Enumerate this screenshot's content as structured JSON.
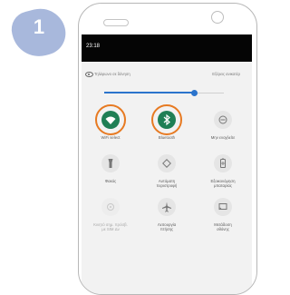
{
  "badge": {
    "number": "1",
    "color": "#a8b8dc"
  },
  "status_bar": {
    "time": "23:18"
  },
  "top_row": {
    "left_text": "Τηλέφωνο σε δόνηση",
    "right_text": "Εξέρεις ανικατέρ"
  },
  "brightness": {
    "level": 0.75,
    "accent": "#2b74cc"
  },
  "tiles": [
    {
      "name": "wifi",
      "icon": "wifi-icon",
      "label": "WiFi select",
      "active": true,
      "highlighted": true
    },
    {
      "name": "bluetooth",
      "icon": "bluetooth-icon",
      "label": "Bluetooth",
      "active": true,
      "highlighted": true
    },
    {
      "name": "do-not-disturb",
      "icon": "minus-circle-icon",
      "label": "Μην ενοχλείτε",
      "active": false
    },
    {
      "name": "flashlight",
      "icon": "flashlight-icon",
      "label": "Φακός",
      "active": false
    },
    {
      "name": "auto-rotate",
      "icon": "rotate-icon",
      "label": "Αυτόματη\nπεριστροφή",
      "active": false
    },
    {
      "name": "battery-saver",
      "icon": "battery-icon",
      "label": "Εξοικονόμηση\nμπαταρίας",
      "active": false
    },
    {
      "name": "hotspot",
      "icon": "hotspot-icon",
      "label": "Κινητό σημ. πρόσβ.\nμε SIM    Δν",
      "active": false,
      "dim": true
    },
    {
      "name": "airplane-mode",
      "icon": "airplane-icon",
      "label": "Λειτουργία\nπτήσης",
      "active": false
    },
    {
      "name": "cast",
      "icon": "cast-icon",
      "label": "Μετάδοση\nοθόνης",
      "active": false
    }
  ],
  "colors": {
    "active_tile": "#1f7f55",
    "highlight_ring": "#e77a22"
  }
}
